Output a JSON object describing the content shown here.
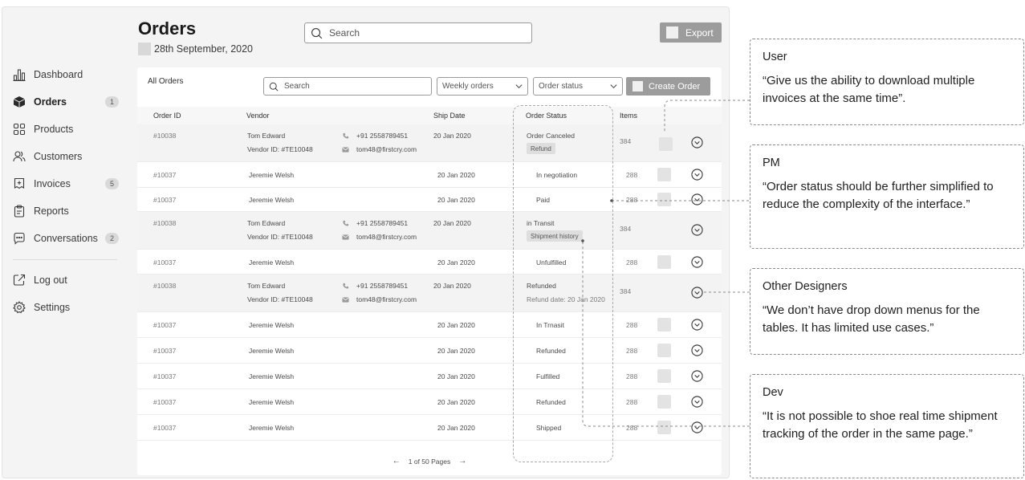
{
  "sidebar": {
    "items": [
      {
        "label": "Dashboard",
        "icon": "chart-bar-icon",
        "badge": ""
      },
      {
        "label": "Orders",
        "icon": "box-icon",
        "badge": "1"
      },
      {
        "label": "Products",
        "icon": "grid-icon",
        "badge": ""
      },
      {
        "label": "Customers",
        "icon": "users-icon",
        "badge": ""
      },
      {
        "label": "Invoices",
        "icon": "invoice-icon",
        "badge": "5"
      },
      {
        "label": "Reports",
        "icon": "clipboard-icon",
        "badge": ""
      },
      {
        "label": "Conversations",
        "icon": "chat-icon",
        "badge": "2"
      }
    ],
    "bottom_items": [
      {
        "label": "Log out",
        "icon": "logout-icon"
      },
      {
        "label": "Settings",
        "icon": "gear-icon"
      }
    ]
  },
  "header": {
    "title": "Orders",
    "date": "28th September, 2020",
    "search_placeholder": "Search",
    "export_label": "Export"
  },
  "card": {
    "title": "All Orders",
    "search_placeholder": "Search",
    "filter_period": "Weekly orders",
    "filter_status": "Order status",
    "create_label": "Create Order",
    "columns": {
      "order_id": "Order ID",
      "vendor": "Vendor",
      "ship_date": "Ship Date",
      "status": "Order Status",
      "items": "Items"
    },
    "rows": [
      {
        "id": "#10038",
        "vendor": "Tom Edward",
        "vendor_id": "Vendor ID: #TE10048",
        "phone": "+91 2558789451",
        "email": "tom48@firstcry.com",
        "date": "20 Jan 2020",
        "status": "Order Canceled",
        "tag": "Refund",
        "items": "384"
      },
      {
        "id": "#10037",
        "vendor": "Jeremie Welsh",
        "date": "20 Jan 2020",
        "status": "In negotiation",
        "items": "288"
      },
      {
        "id": "#10037",
        "vendor": "Jeremie Welsh",
        "date": "20 Jan 2020",
        "status": "Paid",
        "items": "288"
      },
      {
        "id": "#10038",
        "vendor": "Tom Edward",
        "vendor_id": "Vendor ID: #TE10048",
        "phone": "+91 2558789451",
        "email": "tom48@firstcry.com",
        "date": "20 Jan 2020",
        "status": "in Transit",
        "tag": "Shipment history",
        "items": "384"
      },
      {
        "id": "#10037",
        "vendor": "Jeremie Welsh",
        "date": "20 Jan 2020",
        "status": "Unfulfilled",
        "items": "288"
      },
      {
        "id": "#10038",
        "vendor": "Tom Edward",
        "vendor_id": "Vendor ID: #TE10048",
        "phone": "+91 2558789451",
        "email": "tom48@firstcry.com",
        "date": "20 Jan 2020",
        "status": "Refunded",
        "sub": "Refund date: 20 Jan 2020",
        "items": "384"
      },
      {
        "id": "#10037",
        "vendor": "Jeremie Welsh",
        "date": "20 Jan 2020",
        "status": "In Trnasit",
        "items": "288"
      },
      {
        "id": "#10037",
        "vendor": "Jeremie Welsh",
        "date": "20 Jan 2020",
        "status": "Refunded",
        "items": "288"
      },
      {
        "id": "#10037",
        "vendor": "Jeremie Welsh",
        "date": "20 Jan 2020",
        "status": "Fulfilled",
        "items": "288"
      },
      {
        "id": "#10037",
        "vendor": "Jeremie Welsh",
        "date": "20 Jan 2020",
        "status": "Refunded",
        "items": "288"
      },
      {
        "id": "#10037",
        "vendor": "Jeremie Welsh",
        "date": "20 Jan 2020",
        "status": "Shipped",
        "items": "288"
      }
    ],
    "pager": "1 of 50 Pages"
  },
  "notes": [
    {
      "who": "User",
      "quote": "“Give us the ability to download multiple invoices at the same time”."
    },
    {
      "who": "PM",
      "quote": "“Order status should be further simplified to reduce the complexity of the interface.”"
    },
    {
      "who": "Other Designers",
      "quote": "“We don’t have drop down menus for the tables. It has limited use cases.”"
    },
    {
      "who": "Dev",
      "quote": "“It is not possible to shoe real time shipment tracking of the order in the same page.”"
    }
  ]
}
